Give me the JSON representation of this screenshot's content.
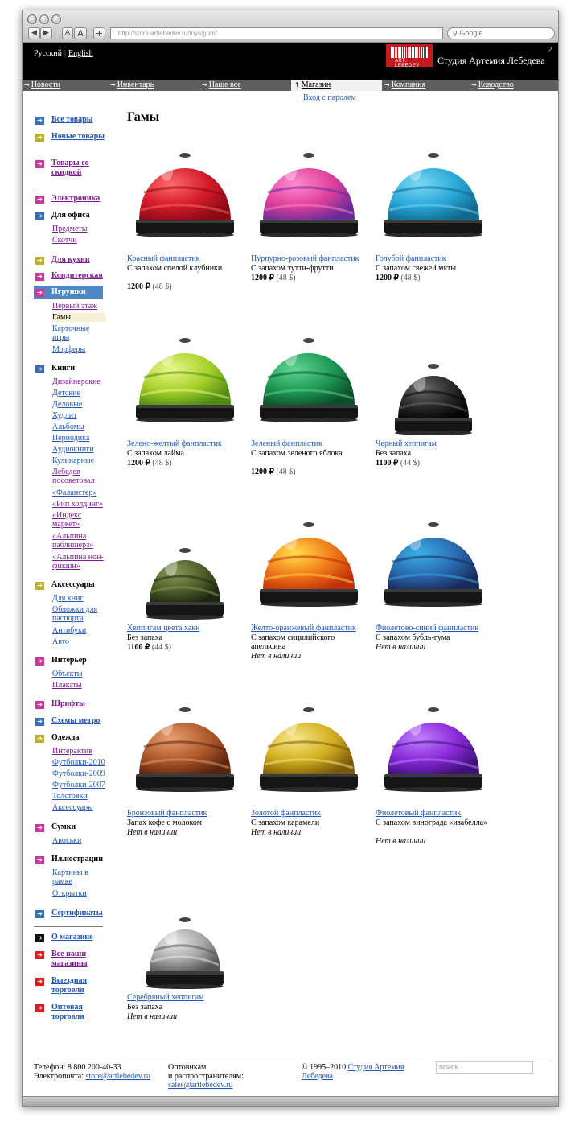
{
  "browser": {
    "url": "http://store.artlebedev.ru/toys/gum/",
    "search_placeholder": "Google",
    "back_label": "◀",
    "forward_label": "▶",
    "font_small_label": "A",
    "font_large_label": "A",
    "add_label": "+"
  },
  "header": {
    "lang_ru": "Русский",
    "lang_sep": "|",
    "lang_en": "English",
    "studio_name": "Студия Артемия Лебедева",
    "logo_text": "ART. LEBEDEV"
  },
  "topnav": [
    {
      "label": "Новости"
    },
    {
      "label": "Инвентарь"
    },
    {
      "label": "Наше все"
    },
    {
      "label": "Магазин"
    },
    {
      "label": "Компания"
    },
    {
      "label": "Ководство"
    }
  ],
  "subnav": {
    "login": "Вход с паролем"
  },
  "sidebar": {
    "all_goods": "Все товары",
    "new_goods": "Новые товары",
    "sale_goods": "Товары со скидкой",
    "electronics": "Электроника",
    "office": "Для офиса",
    "office_items": [
      "Предметы",
      "Скотчи"
    ],
    "kitchen": "Для кухни",
    "confectionery": "Кондитерская",
    "toys": "Игрушки",
    "toys_items": [
      "Первый этаж",
      "Гамы",
      "Карточные игры",
      "Морферы"
    ],
    "books": "Книги",
    "books_items": [
      "Дизайнерские",
      "Детские",
      "Деловые",
      "Худлит",
      "Альбомы",
      "Периодика",
      "Аудиокниги",
      "Кулинарные",
      "Лебедев посоветовал",
      "«Фаланстер»",
      "«Рип холдинг»",
      "«Индекс маркет»",
      "«Альпина паблишерз»",
      "«Альпина нон-фикшн»"
    ],
    "accessories": "Аксессуары",
    "accessories_items": [
      "Для книг",
      "Обложки для паспорта",
      "Антибуки",
      "Авто"
    ],
    "interior": "Интерьер",
    "interior_items": [
      "Объекты",
      "Плакаты"
    ],
    "fonts": "Шрифты",
    "metro": "Схемы метро",
    "clothes": "Одежда",
    "clothes_items": [
      "Интерактив",
      "Футболки-2010",
      "Футболки-2009",
      "Футболки-2007",
      "Толстовки",
      "Аксессуары"
    ],
    "bags": "Сумки",
    "bags_items": [
      "Авоськи"
    ],
    "illustrations": "Иллюстрации",
    "illustrations_items": [
      "Картины в рамке",
      "Открытки"
    ],
    "certificates": "Сертификаты",
    "about": "О магазине",
    "all_shops": "Все наши магазины",
    "outdoor": "Выездная торговля",
    "wholesale": "Оптовая торговля"
  },
  "page": {
    "title": "Гамы"
  },
  "products": [
    {
      "name": "Красный фанпластик",
      "desc": "С запахом спелой клубники",
      "price": "1200 ₽",
      "usd": "(48 $)",
      "stock": "",
      "color": "#d41a2a",
      "dark": "#8a0a14",
      "light": "#ff6a6a"
    },
    {
      "name": "Пурпурно-розовый фанпластик",
      "desc": "С запахом тутти-фрутти",
      "price": "1200 ₽",
      "usd": "(48 $)",
      "stock": "",
      "color": "#e0409a",
      "dark": "#6a2a9a",
      "light": "#ff8ad0"
    },
    {
      "name": "Голубой фанпластик",
      "desc": "С запахом свежей мяты",
      "price": "1200 ₽",
      "usd": "(48 $)",
      "stock": "",
      "color": "#2aa8d8",
      "dark": "#11698e",
      "light": "#7ad8f6"
    },
    {
      "name": "Зелено-желтый фанпластик",
      "desc": "С запахом лайма",
      "price": "1200 ₽",
      "usd": "(48 $)",
      "stock": "",
      "color": "#a8d22a",
      "dark": "#4e8a14",
      "light": "#eaf78a"
    },
    {
      "name": "Зеленый фанпластик",
      "desc": "С запахом зеленого яблока",
      "price": "1200 ₽",
      "usd": "(48 $)",
      "stock": "",
      "color": "#1f9a56",
      "dark": "#0b4e2a",
      "light": "#5fd693"
    },
    {
      "name": "Черный хеппигам",
      "desc": "Без запаха",
      "price": "1100 ₽",
      "usd": "(44 $)",
      "stock": "",
      "color": "#2a2a2a",
      "dark": "#050505",
      "light": "#6a6a6a"
    },
    {
      "name": "Хеппигам цвета хаки",
      "desc": "Без запаха",
      "price": "1100 ₽",
      "usd": "(44 $)",
      "stock": "",
      "color": "#4f5f2a",
      "dark": "#1e2610",
      "light": "#8a9a5a"
    },
    {
      "name": "Желто-оранжевый фанпластик",
      "desc": "С запахом сицилийского апельсина",
      "price": "",
      "usd": "",
      "stock": "Нет в наличии",
      "color": "#f07a1a",
      "dark": "#c0300a",
      "light": "#ffe04a"
    },
    {
      "name": "Фиолетово-синий фанпластик",
      "desc": "С запахом бубль-гума",
      "price": "",
      "usd": "",
      "stock": "Нет в наличии",
      "color": "#2a6ab0",
      "dark": "#1a2a5a",
      "light": "#3ab0e8"
    },
    {
      "name": "Бронзовый фанпластик",
      "desc": "Запах кофе с молоком",
      "price": "",
      "usd": "",
      "stock": "Нет в наличии",
      "color": "#b05a2a",
      "dark": "#5a2410",
      "light": "#e8a070"
    },
    {
      "name": "Золотой фанпластик",
      "desc": "С запахом карамели",
      "price": "",
      "usd": "",
      "stock": "Нет в наличии",
      "color": "#d4b020",
      "dark": "#7a5a0a",
      "light": "#f8e88a"
    },
    {
      "name": "Фиолетовый фанпластик",
      "desc": "С запахом винограда «изабелла»",
      "price": "",
      "usd": "",
      "stock": "Нет в наличии",
      "color": "#8a2ad8",
      "dark": "#40107a",
      "light": "#c080ff"
    },
    {
      "name": "Серебряный хеппигам",
      "desc": "Без запаха",
      "price": "",
      "usd": "",
      "stock": "Нет в наличии",
      "color": "#a8a8a8",
      "dark": "#555555",
      "light": "#e8e8e8"
    }
  ],
  "footer": {
    "phone": "Телефон: 8 800 200-40-33",
    "email_label": "Электропочта:",
    "email": "store@artlebedev.ru",
    "wholesale_1": "Оптовикам",
    "wholesale_2": "и распространителям:",
    "wholesale_email": "sales@artlebedev.ru",
    "copyright": "© 1995–2010",
    "studio_link": "Студия Артемия Лебедева",
    "search_placeholder": "поиск"
  },
  "colors": {
    "link": "#2058b8",
    "visited": "#7a1f8f",
    "icon_blue": "#3a6fb8",
    "icon_olive": "#b8b030",
    "icon_pink": "#c83a9a",
    "icon_black": "#111111",
    "icon_red": "#d42020"
  }
}
